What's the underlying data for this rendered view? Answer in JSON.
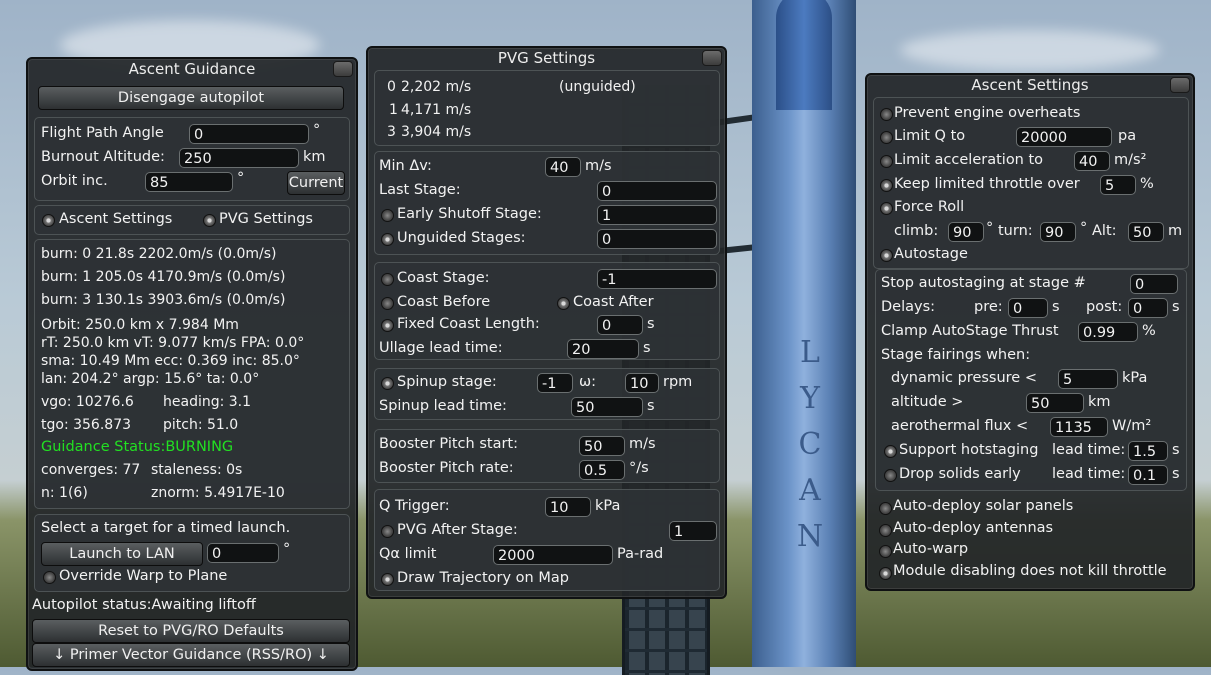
{
  "ascent_guidance": {
    "title": "Ascent Guidance",
    "disengage_label": "Disengage autopilot",
    "flight_path_angle": {
      "label": "Flight Path Angle",
      "value": "0",
      "unit": "°"
    },
    "burnout_altitude": {
      "label": "Burnout Altitude:",
      "value": "250",
      "unit": "km"
    },
    "orbit_inc": {
      "label": "Orbit inc.",
      "value": "85",
      "unit": "°",
      "button": "Current"
    },
    "toggle_ascent_settings": "Ascent Settings",
    "toggle_pvg_settings": "PVG Settings",
    "burn_lines": [
      "burn: 0 21.8s 2202.0m/s (0.0m/s)",
      "burn: 1 205.0s 4170.9m/s (0.0m/s)",
      "burn: 3 130.1s 3903.6m/s (0.0m/s)"
    ],
    "orbit_lines": [
      "Orbit: 250.0 km x 7.984 Mm",
      "rT: 250.0 km vT: 9.077 km/s FPA: 0.0°",
      "sma: 10.49 Mm ecc: 0.369 inc: 85.0°",
      "lan: 204.2° argp: 15.6° ta: 0.0°"
    ],
    "vgo": "vgo: 10276.6",
    "heading": "heading: 3.1",
    "tgo": "tgo: 356.873",
    "pitch": "pitch: 51.0",
    "guidance_status": "Guidance Status:BURNING",
    "converges": "converges: 77",
    "staleness": "staleness: 0s",
    "n": "n: 1(6)",
    "znorm": "znorm: 5.4917E-10",
    "select_target": "Select a target for a timed launch.",
    "launch_to_lan": "Launch to LAN",
    "lan_value": "0",
    "lan_unit": "°",
    "override_warp": "Override Warp to Plane",
    "autopilot_status": "Autopilot status:Awaiting liftoff",
    "reset_label": "Reset to PVG/RO Defaults",
    "mode_label": "↓ Primer Vector Guidance (RSS/RO) ↓"
  },
  "pvg_settings": {
    "title": "PVG Settings",
    "stages": [
      {
        "stage": "0",
        "dv": "2,202 m/s",
        "note": "(unguided)"
      },
      {
        "stage": "1",
        "dv": "4,171 m/s",
        "note": ""
      },
      {
        "stage": "3",
        "dv": "3,904 m/s",
        "note": ""
      }
    ],
    "min_dv": {
      "label": "Min Δv:",
      "value": "40",
      "unit": "m/s"
    },
    "last_stage": {
      "label": "Last Stage:",
      "value": "0"
    },
    "early_shutoff": {
      "label": "Early Shutoff Stage:",
      "value": "1"
    },
    "unguided_stages": {
      "label": "Unguided Stages:",
      "value": "0"
    },
    "coast_stage": {
      "label": "Coast Stage:",
      "value": "-1"
    },
    "coast_before": "Coast Before",
    "coast_after": "Coast After",
    "fixed_coast": {
      "label": "Fixed Coast Length:",
      "value": "0",
      "unit": "s"
    },
    "ullage": {
      "label": "Ullage lead time:",
      "value": "20",
      "unit": "s"
    },
    "spinup_stage": {
      "label": "Spinup stage:",
      "value": "-1",
      "omega_label": "ω:",
      "omega": "10",
      "unit": "rpm"
    },
    "spinup_lead": {
      "label": "Spinup lead time:",
      "value": "50",
      "unit": "s"
    },
    "booster_pitch_start": {
      "label": "Booster Pitch start:",
      "value": "50",
      "unit": "m/s"
    },
    "booster_pitch_rate": {
      "label": "Booster Pitch rate:",
      "value": "0.5",
      "unit": "°/s"
    },
    "q_trigger": {
      "label": "Q Trigger:",
      "value": "10",
      "unit": "kPa"
    },
    "pvg_after_stage": {
      "label": "PVG After Stage:",
      "value": "1"
    },
    "qa_limit": {
      "label": "Qα limit",
      "value": "2000",
      "unit": "Pa-rad"
    },
    "draw_trajectory": "Draw Trajectory on Map"
  },
  "ascent_settings": {
    "title": "Ascent Settings",
    "prevent_overheats": "Prevent engine overheats",
    "limit_q": {
      "label": "Limit Q to",
      "value": "20000",
      "unit": "pa"
    },
    "limit_accel": {
      "label": "Limit acceleration to",
      "value": "40",
      "unit": "m/s²"
    },
    "keep_throttle": {
      "label": "Keep limited throttle over",
      "value": "5",
      "unit": "%"
    },
    "force_roll": "Force Roll",
    "climb": {
      "label": "climb:",
      "value": "90",
      "unit": "°"
    },
    "turn": {
      "label": "turn:",
      "value": "90",
      "unit": "°"
    },
    "alt": {
      "label": "Alt:",
      "value": "50",
      "unit": "m"
    },
    "autostage": "Autostage",
    "stop_autostaging": {
      "label": "Stop autostaging at stage #",
      "value": "0"
    },
    "delays": {
      "label": "Delays:",
      "pre_label": "pre:",
      "pre": "0",
      "post_label": "post:",
      "post": "0",
      "unit": "s"
    },
    "clamp_thrust": {
      "label": "Clamp AutoStage Thrust",
      "value": "0.99",
      "unit": "%"
    },
    "stage_fairings": "Stage fairings when:",
    "dynamic_pressure": {
      "label": "dynamic pressure <",
      "value": "5",
      "unit": "kPa"
    },
    "altitude": {
      "label": "altitude >",
      "value": "50",
      "unit": "km"
    },
    "aero_flux": {
      "label": "aerothermal flux <",
      "value": "1135",
      "unit": "W/m²"
    },
    "support_hotstaging": {
      "label": "Support hotstaging",
      "lead_label": "lead time:",
      "value": "1.5",
      "unit": "s"
    },
    "drop_solids": {
      "label": "Drop solids early",
      "lead_label": "lead time:",
      "value": "0.1",
      "unit": "s"
    },
    "auto_solar": "Auto-deploy solar panels",
    "auto_antennas": "Auto-deploy antennas",
    "auto_warp": "Auto-warp",
    "module_disabling": "Module disabling does not kill throttle"
  },
  "rocket_letters": [
    "L",
    "Y",
    "C",
    "A",
    "N"
  ]
}
